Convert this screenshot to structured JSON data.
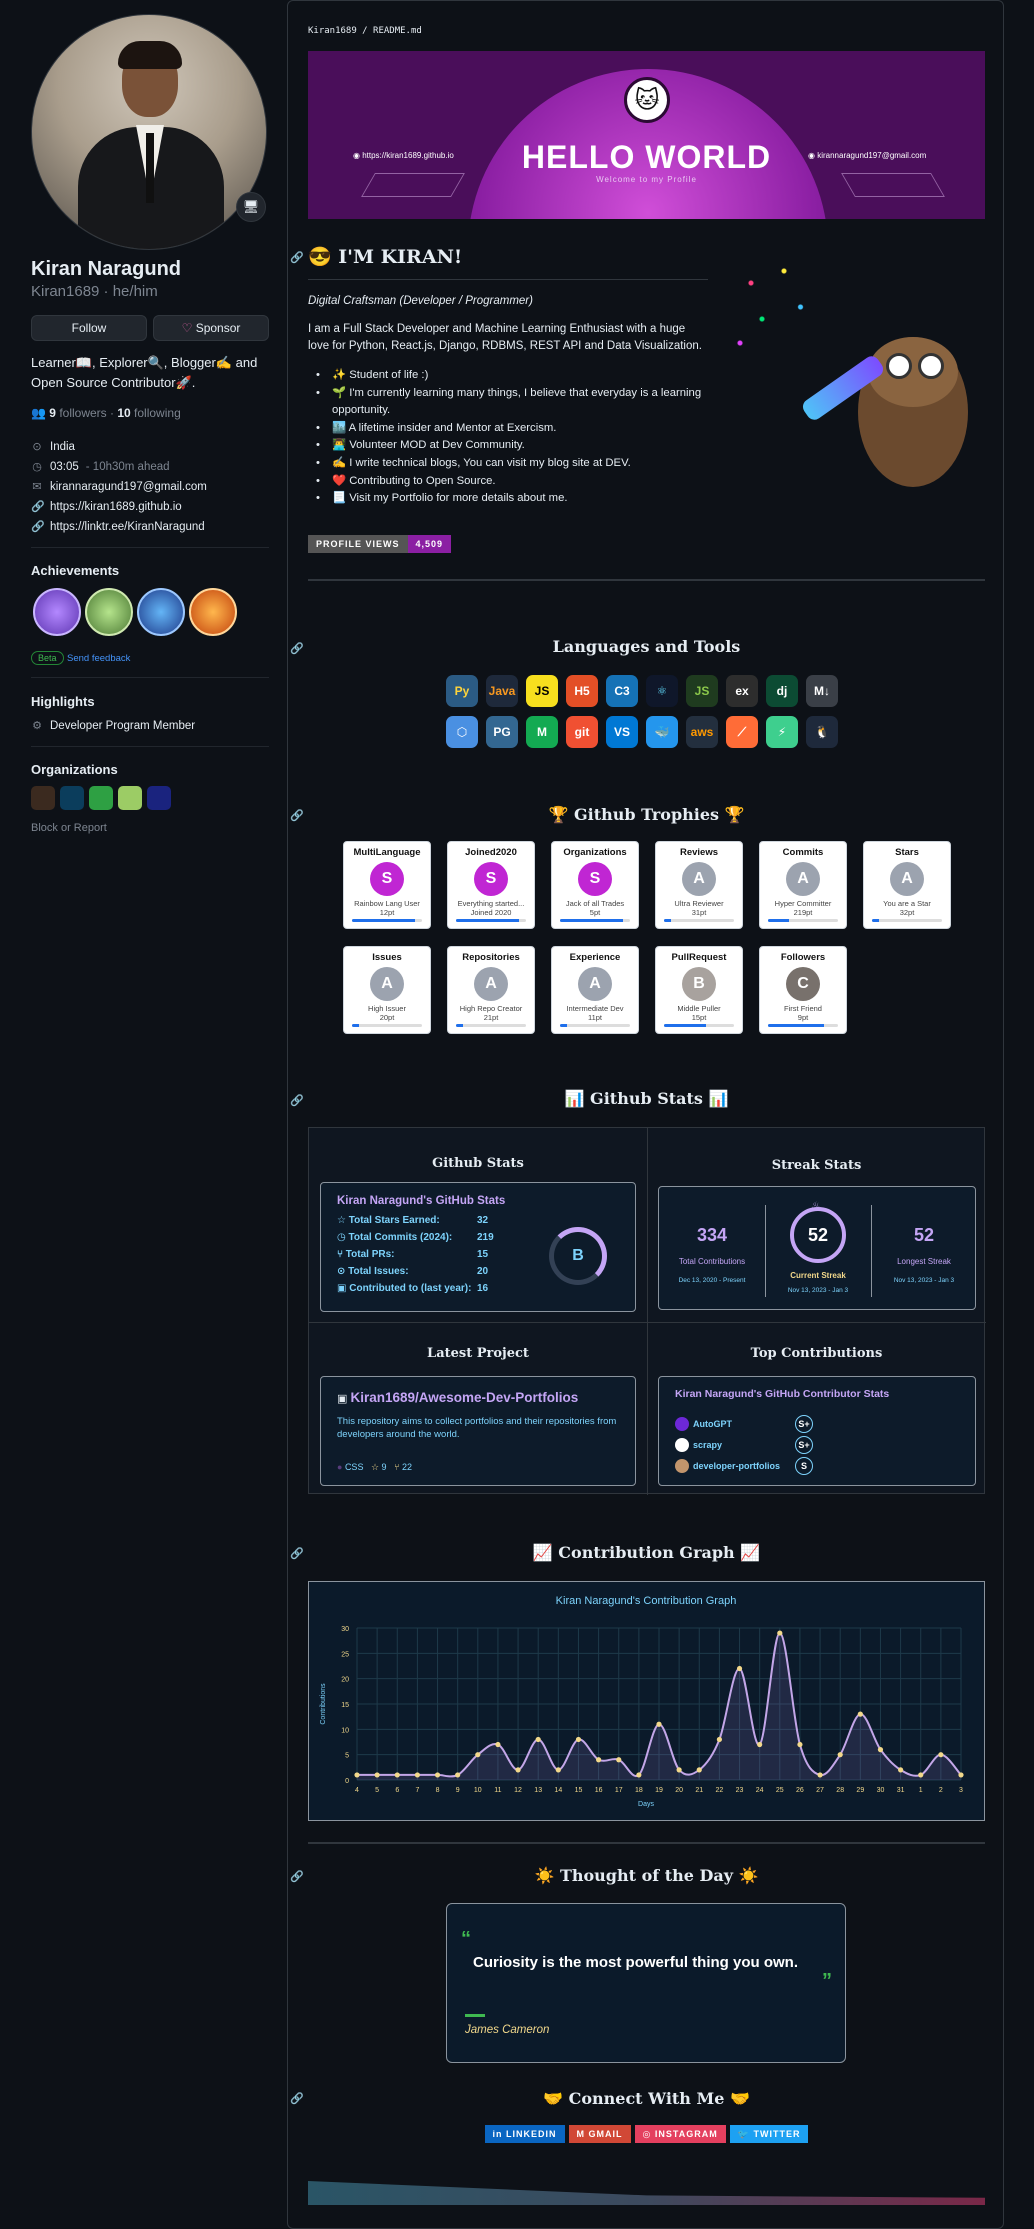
{
  "profile": {
    "name": "Kiran Naragund",
    "login": "Kiran1689 · he/him",
    "follow_label": "Follow",
    "sponsor_label": "Sponsor",
    "bio": "Learner📖, Explorer🔍, Blogger✍️ and Open Source Contributor🚀.",
    "followers": "9",
    "followers_label": "followers",
    "following": "10",
    "following_label": "following",
    "location": "India",
    "time": "03:05",
    "time_note": "- 10h30m ahead",
    "email": "kirannaragund197@gmail.com",
    "website": "https://kiran1689.github.io",
    "social": "https://linktr.ee/KiranNaragund"
  },
  "achievements": {
    "title": "Achievements",
    "beta": "Beta",
    "feedback": "Send feedback"
  },
  "highlights": {
    "title": "Highlights",
    "item": "Developer Program Member"
  },
  "organizations": {
    "title": "Organizations",
    "block": "Block or Report"
  },
  "readme": {
    "path": "Kiran1689 / README.md",
    "banner_title": "HELLO WORLD",
    "banner_sub": "Welcome to my Profile",
    "banner_site": "https://kiran1689.github.io",
    "banner_mail": "kirannaragund197@gmail.com",
    "intro_title": "I'M KIRAN!",
    "role": "Digital Craftsman (Developer / Programmer)",
    "about": "I am a Full Stack Developer and Machine Learning Enthusiast with a huge love for Python, React.js, Django, RDBMS, REST API and Data Visualization.",
    "bullets": [
      "✨ Student of life :)",
      "🌱 I'm currently learning many things, I believe that everyday is a learning opportunity.",
      "🏙️ A lifetime insider and Mentor at Exercism.",
      "👨‍💻 Volunteer MOD at Dev Community.",
      "✍️ I write technical blogs, You can visit my blog site at DEV.",
      "❤️ Contributing to Open Source.",
      "📃 Visit my Portfolio for more details about me."
    ],
    "views_label": "PROFILE VIEWS",
    "views_value": "4,509",
    "languages_title": "Languages and Tools",
    "trophies_title": "🏆 Github Trophies 🏆",
    "stats_title": "📊 Github Stats 📊",
    "contrib_title": "📈 Contribution Graph 📈",
    "thought_title": "☀️ Thought of the Day ☀️",
    "connect_title": "🤝 Connect With Me 🤝"
  },
  "tools": [
    "Py",
    "Java",
    "JS",
    "H5",
    "C3",
    "⚛",
    "JS",
    "ex",
    "dj",
    "M↓",
    "⬡",
    "PG",
    "M",
    "git",
    "VS",
    "🐳",
    "aws",
    "⟋",
    "⚡",
    "🐧"
  ],
  "trophies": [
    {
      "title": "MultiLanguage",
      "rank": "S",
      "sub": "Rainbow Lang User",
      "pts": "12pt",
      "fill": 0.9
    },
    {
      "title": "Joined2020",
      "rank": "S",
      "sub": "Everything started...",
      "pts": "Joined 2020",
      "fill": 0.9
    },
    {
      "title": "Organizations",
      "rank": "S",
      "sub": "Jack of all Trades",
      "pts": "5pt",
      "fill": 0.9
    },
    {
      "title": "Reviews",
      "rank": "A",
      "sub": "Ultra Reviewer",
      "pts": "31pt",
      "fill": 0.1
    },
    {
      "title": "Commits",
      "rank": "A",
      "sub": "Hyper Committer",
      "pts": "219pt",
      "fill": 0.3
    },
    {
      "title": "Stars",
      "rank": "A",
      "sub": "You are a Star",
      "pts": "32pt",
      "fill": 0.1
    },
    {
      "title": "Issues",
      "rank": "A",
      "sub": "High Issuer",
      "pts": "20pt",
      "fill": 0.1
    },
    {
      "title": "Repositories",
      "rank": "A",
      "sub": "High Repo Creator",
      "pts": "21pt",
      "fill": 0.1
    },
    {
      "title": "Experience",
      "rank": "A",
      "sub": "Intermediate Dev",
      "pts": "11pt",
      "fill": 0.1
    },
    {
      "title": "PullRequest",
      "rank": "B",
      "sub": "Middle Puller",
      "pts": "15pt",
      "fill": 0.6
    },
    {
      "title": "Followers",
      "rank": "C",
      "sub": "First Friend",
      "pts": "9pt",
      "fill": 0.8
    }
  ],
  "stats": {
    "heading": "Github Stats",
    "title": "Kiran Naragund's GitHub Stats",
    "rows": [
      {
        "k": "Total Stars Earned:",
        "v": "32"
      },
      {
        "k": "Total Commits (2024):",
        "v": "219"
      },
      {
        "k": "Total PRs:",
        "v": "15"
      },
      {
        "k": "Total Issues:",
        "v": "20"
      },
      {
        "k": "Contributed to (last year):",
        "v": "16"
      }
    ],
    "grade": "B"
  },
  "streak": {
    "heading": "Streak Stats",
    "total": "334",
    "total_label": "Total Contributions",
    "total_range": "Dec 13, 2020 - Present",
    "current": "52",
    "current_label": "Current Streak",
    "current_range": "Nov 13, 2023 - Jan 3",
    "longest": "52",
    "longest_label": "Longest Streak",
    "longest_range": "Nov 13, 2023 - Jan 3"
  },
  "project": {
    "heading": "Latest Project",
    "name": "Kiran1689/Awesome-Dev-Portfolios",
    "desc": "This repository aims to collect portfolios and their repositories from developers around the world.",
    "lang": "CSS",
    "stars": "9",
    "forks": "22"
  },
  "topcontrib": {
    "heading": "Top Contributions",
    "title": "Kiran Naragund's GitHub Contributor Stats",
    "repos": [
      {
        "name": "AutoGPT",
        "rank": "S+"
      },
      {
        "name": "scrapy",
        "rank": "S+"
      },
      {
        "name": "developer-portfolios",
        "rank": "S"
      }
    ]
  },
  "chart_data": {
    "type": "line",
    "title": "Kiran Naragund's Contribution Graph",
    "xlabel": "Days",
    "ylabel": "Contributions",
    "categories": [
      "4",
      "5",
      "6",
      "7",
      "8",
      "9",
      "10",
      "11",
      "12",
      "13",
      "14",
      "15",
      "16",
      "17",
      "18",
      "19",
      "20",
      "21",
      "22",
      "23",
      "24",
      "25",
      "26",
      "27",
      "28",
      "29",
      "30",
      "31",
      "1",
      "2",
      "3"
    ],
    "values": [
      1,
      1,
      1,
      1,
      1,
      1,
      5,
      7,
      2,
      8,
      2,
      8,
      4,
      4,
      1,
      11,
      2,
      2,
      8,
      22,
      7,
      29,
      7,
      1,
      5,
      13,
      6,
      2,
      1,
      5,
      1
    ],
    "ylim": [
      0,
      30
    ],
    "yticks": [
      0,
      5,
      10,
      15,
      20,
      25,
      30
    ],
    "grid": true
  },
  "thought": {
    "quote": "Curiosity is the most powerful thing you own.",
    "author": "James Cameron"
  },
  "connect": [
    "LINKEDIN",
    "GMAIL",
    "INSTAGRAM",
    "TWITTER"
  ],
  "colors": {
    "accent": "#4493f8",
    "purple": "#a371f7",
    "chart_line": "#c3a6e8",
    "point": "#f2d88b"
  }
}
